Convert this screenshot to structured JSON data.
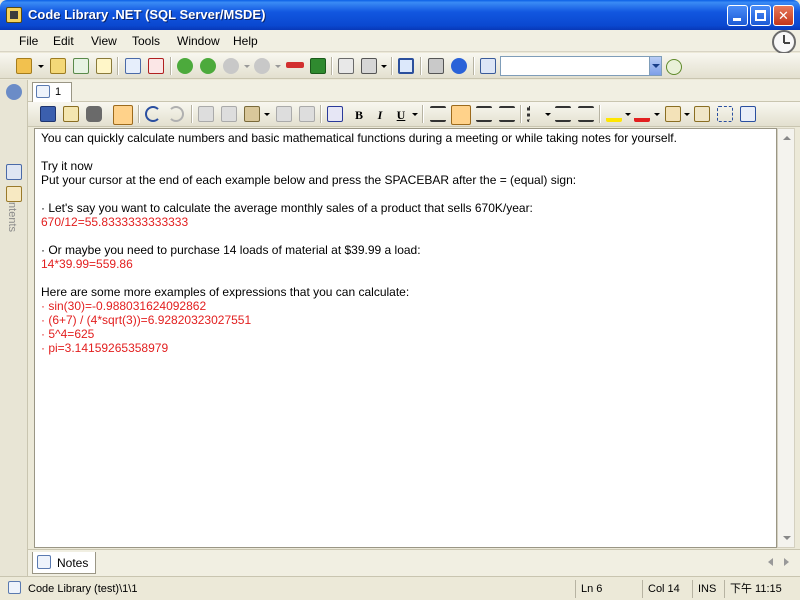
{
  "window": {
    "title": "Code Library .NET (SQL Server/MSDE)"
  },
  "menu": [
    "File",
    "Edit",
    "View",
    "Tools",
    "Window",
    "Help"
  ],
  "tabs": {
    "document_tab": "1"
  },
  "sidebar": {
    "panel_label": "Contents"
  },
  "formatting": {
    "bold": "B",
    "italic": "I",
    "underline": "U"
  },
  "editor": {
    "lines": [
      {
        "text": "You can quickly calculate numbers and basic mathematical functions during a meeting or while taking notes for yourself.",
        "color": "black"
      },
      {
        "text": "",
        "color": "black"
      },
      {
        "text": "Try it now",
        "color": "black"
      },
      {
        "text": "Put your cursor at the end of each example below and press the SPACEBAR after the = (equal) sign:",
        "color": "black"
      },
      {
        "text": "",
        "color": "black"
      },
      {
        "text": "· Let's say you want to calculate the average monthly sales of a product that sells 670K/year:",
        "color": "black"
      },
      {
        "text": "670/12=55.8333333333333",
        "color": "red"
      },
      {
        "text": "",
        "color": "black"
      },
      {
        "text": "· Or maybe you need to purchase 14 loads of material at $39.99 a load:",
        "color": "black"
      },
      {
        "text": "14*39.99=559.86",
        "color": "red"
      },
      {
        "text": "",
        "color": "black"
      },
      {
        "text": "Here are some more examples of expressions that you can calculate:",
        "color": "black"
      },
      {
        "text": "· sin(30)=-0.988031624092862",
        "color": "red"
      },
      {
        "text": "· (6+7) / (4*sqrt(3))=6.92820323027551",
        "color": "red"
      },
      {
        "text": "· 5^4=625",
        "color": "red"
      },
      {
        "text": "· pi=3.14159265358979",
        "color": "red"
      }
    ]
  },
  "notes_tab": {
    "label": "Notes"
  },
  "status": {
    "path": "Code Library (test)\\1\\1",
    "line": "Ln 6",
    "col": "Col 14",
    "mode": "INS",
    "time": "下午 11:15"
  },
  "colors": {
    "titlebar": "#0a48d0",
    "calc_result": "#e21f1f",
    "active_toggle": "#ffd28a"
  }
}
